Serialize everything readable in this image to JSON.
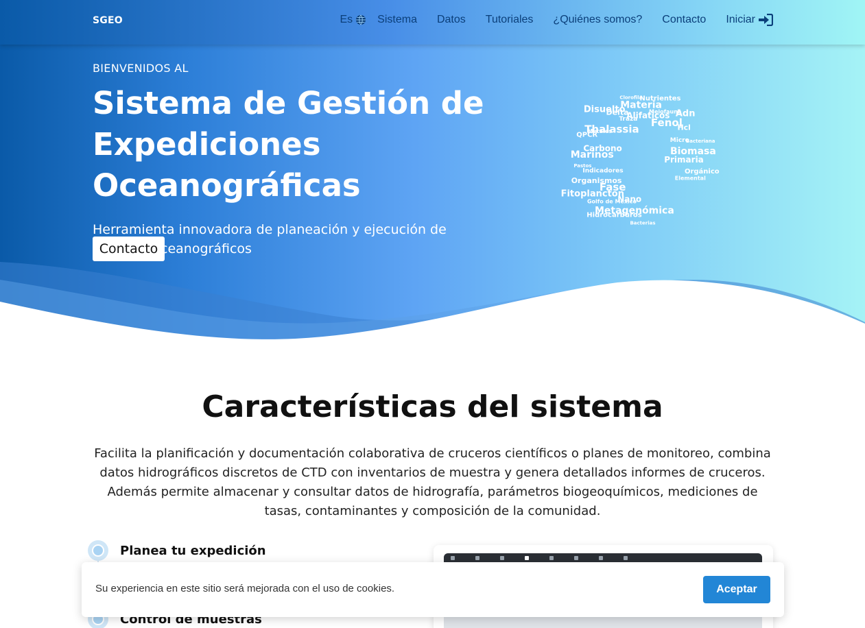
{
  "navbar": {
    "brand": "SGEO",
    "lang": "Es",
    "items": [
      "Sistema",
      "Datos",
      "Tutoriales",
      "¿Quiénes somos?",
      "Contacto"
    ],
    "login": "Iniciar"
  },
  "hero": {
    "welcome": "BIENVENIDOS AL",
    "title": "Sistema de Gestión de Expediciones Oceanográficas",
    "subtitle": "Herramienta innovadora de planeación y ejecución de cruceros oceanográficos",
    "cta": "Contacto",
    "wordcloud_words": [
      "Bacterias",
      "Metagenómica",
      "Nano",
      "Hidrocarburos",
      "Golfo de México",
      "Fase",
      "Fitoplancton",
      "Organismos",
      "Indicadores",
      "Pastos",
      "Marinos",
      "Carbono",
      "QPCR",
      "Metales",
      "Thalassia",
      "Disuelto",
      "Delta",
      "Traza",
      "Clorofila",
      "Materia",
      "Alifaticos",
      "Nutrientes",
      "Meiofauna",
      "Fenol",
      "Adn",
      "Hcl",
      "Micro",
      "Bacteriana",
      "Biomasa",
      "Primaria",
      "Orgánico",
      "Elemental"
    ]
  },
  "features": {
    "title": "Características del sistema",
    "description": "Facilita la planificación y documentación colaborativa de cruceros científicos o planes de monitoreo, combina datos hidrográficos discretos de CTD con inventarios de muestra y genera detallados informes de cruceros. Además permite almacenar y consultar datos de hidrografía, parámetros biogeoquímicos, mediciones de tasas, contaminantes y composición de la comunidad.",
    "steps": [
      "Planea tu expedición",
      "Control de muestras"
    ]
  },
  "cookie": {
    "message": "Su experiencia en este sitio será mejorada con el uso de cookies.",
    "accept": "Aceptar"
  },
  "colors": {
    "nav_text": "#0b3f7a",
    "accept_button": "#2286d6",
    "hero_start": "#0a5aa8",
    "hero_end": "#a5f3f6"
  }
}
